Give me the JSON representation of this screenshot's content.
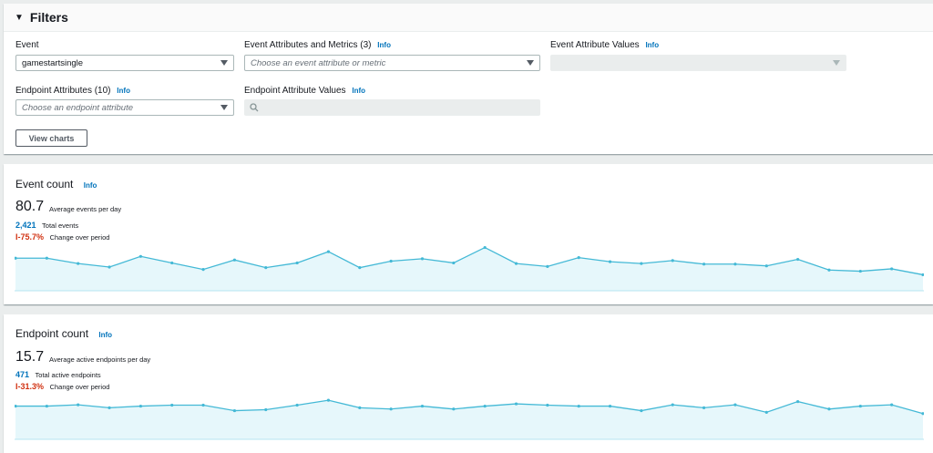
{
  "colors": {
    "link": "#0073bb",
    "negative": "#d13212",
    "line": "#44b9d6",
    "fill": "#e6f7fb"
  },
  "filters": {
    "title": "Filters",
    "event": {
      "label": "Event",
      "value": "gamestartsingle"
    },
    "event_attributes": {
      "label": "Event Attributes and Metrics (3)",
      "info": "Info",
      "placeholder": "Choose an event attribute or metric"
    },
    "event_attribute_values": {
      "label": "Event Attribute Values",
      "info": "Info",
      "value": ""
    },
    "endpoint_attributes": {
      "label": "Endpoint Attributes (10)",
      "info": "Info",
      "placeholder": "Choose an endpoint attribute"
    },
    "endpoint_attribute_values": {
      "label": "Endpoint Attribute Values",
      "info": "Info",
      "placeholder": ""
    },
    "view_charts_label": "View charts"
  },
  "event_count": {
    "title": "Event count",
    "info": "Info",
    "avg_value": "80.7",
    "avg_label": "Average events per day",
    "total_value": "2,421",
    "total_label": "Total events",
    "change_value": "-75.7%",
    "change_label": "Change over period"
  },
  "endpoint_count": {
    "title": "Endpoint count",
    "info": "Info",
    "avg_value": "15.7",
    "avg_label": "Average active endpoints per day",
    "total_value": "471",
    "total_label": "Total active endpoints",
    "change_value": "-31.3%",
    "change_label": "Change over period"
  },
  "chart_data": [
    {
      "type": "area",
      "series": [
        {
          "values": [
            85,
            85,
            76,
            70,
            88,
            77,
            66,
            82,
            69,
            77,
            96,
            69,
            80,
            84,
            77,
            103,
            76,
            71,
            86,
            79,
            76,
            81,
            75,
            75,
            72,
            83,
            65,
            63,
            67,
            57
          ]
        }
      ],
      "ylim": [
        30,
        110
      ]
    },
    {
      "type": "area",
      "series": [
        {
          "values": [
            16.2,
            16.2,
            16.6,
            15.7,
            16.2,
            16.5,
            16.5,
            14.8,
            15.1,
            16.5,
            18.0,
            15.7,
            15.3,
            16.2,
            15.3,
            16.2,
            16.9,
            16.5,
            16.2,
            16.2,
            14.8,
            16.6,
            15.7,
            16.6,
            14.3,
            17.6,
            15.3,
            16.2,
            16.6,
            13.9
          ]
        }
      ],
      "ylim": [
        6,
        20
      ]
    }
  ]
}
